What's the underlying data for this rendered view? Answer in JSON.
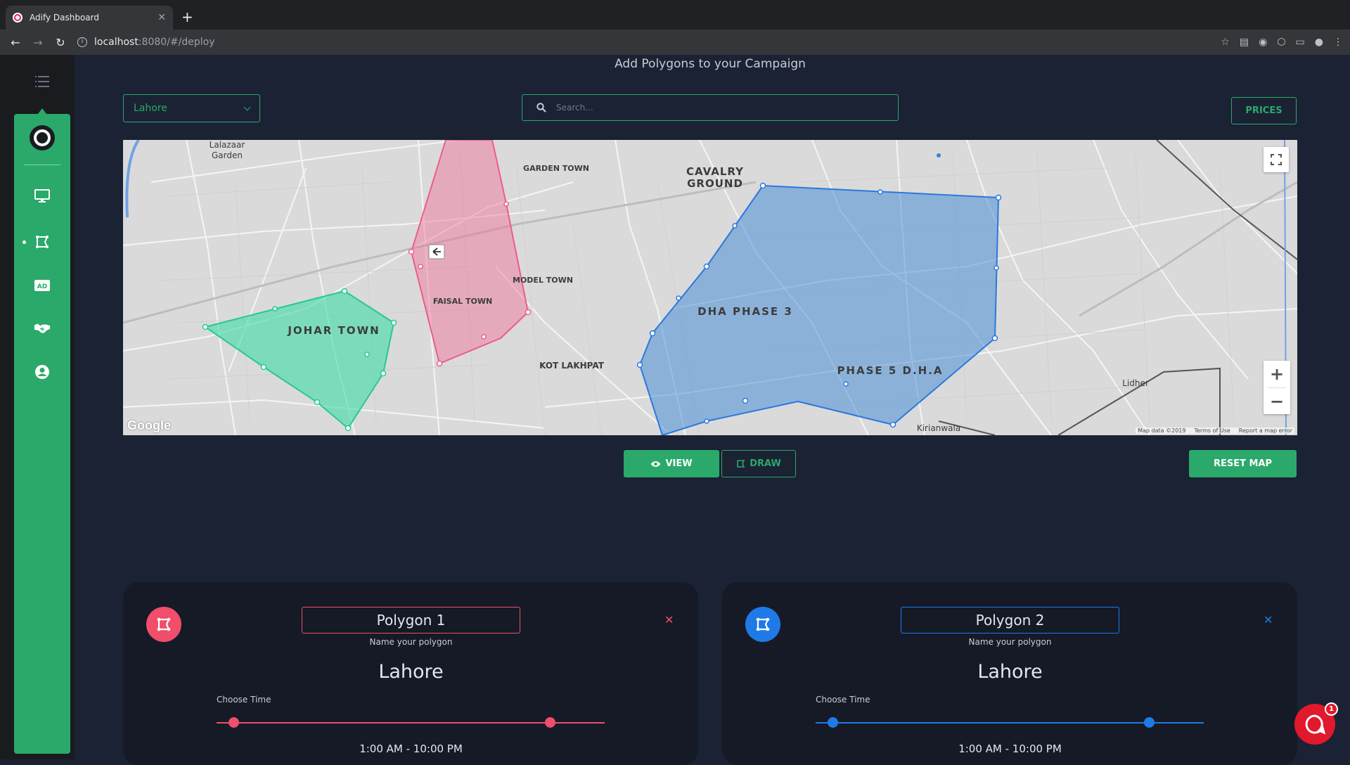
{
  "browser": {
    "tab_title": "Adify Dashboard",
    "url_host": "localhost",
    "url_path": ":8080/#/deploy"
  },
  "page": {
    "heading": "Add Polygons to your Campaign"
  },
  "controls": {
    "city_value": "Lahore",
    "search_placeholder": "Search...",
    "prices_label": "PRICES"
  },
  "map": {
    "labels": {
      "lalazaar": "Lalazaar",
      "garden": "Garden",
      "cavalry_1": "CAVALRY",
      "cavalry_2": "GROUND",
      "garden_town": "GARDEN TOWN",
      "model_town": "MODEL TOWN",
      "faisal_town": "FAISAL TOWN",
      "johar_town": "JOHAR TOWN",
      "dha_phase3": "DHA PHASE 3",
      "phase5": "PHASE 5 D.H.A",
      "kot_lakhpat": "KOT LAKHPAT",
      "lidher": "Lidher",
      "kirianwala": "Kirianwala"
    },
    "google": "Google",
    "attribution": [
      "Map data ©2019",
      "Terms of Use",
      "Report a map error"
    ],
    "colors": {
      "polygon1": "#ef6f97",
      "polygon2": "#4a90d9",
      "polygon3": "#3ddca6"
    }
  },
  "actions": {
    "view_label": "VIEW",
    "draw_label": "DRAW",
    "reset_label": "RESET MAP"
  },
  "cards": [
    {
      "name": "Polygon 1",
      "hint": "Name your polygon",
      "city": "Lahore",
      "choose_time": "Choose Time",
      "time_range": "1:00 AM - 10:00 PM",
      "color": "#f04e6a",
      "slider": {
        "start_fraction": 0.045,
        "end_fraction": 0.86
      }
    },
    {
      "name": "Polygon 2",
      "hint": "Name your polygon",
      "city": "Lahore",
      "choose_time": "Choose Time",
      "time_range": "1:00 AM - 10:00 PM",
      "color": "#1f7ae8",
      "slider": {
        "start_fraction": 0.045,
        "end_fraction": 0.86
      }
    }
  ],
  "chat": {
    "unread": "1"
  }
}
